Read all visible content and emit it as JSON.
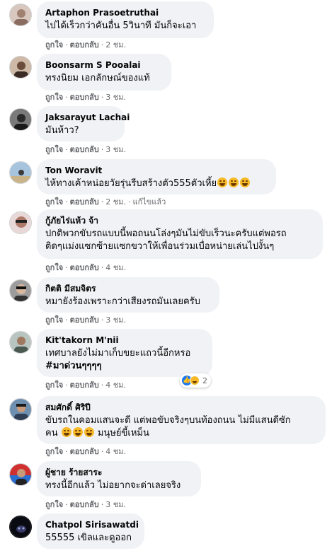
{
  "actions": {
    "like": "ถูกใจ",
    "reply": "ตอบกลับ",
    "edited": "แก้ไขแล้ว",
    "separator": "·"
  },
  "comments": [
    {
      "author": "Artaphon Prasoetruthai",
      "lines": [
        "ไปได้เร็วกว่าคันอื่น 5วินาที มันก็จะเอา"
      ],
      "time": "2 ชม."
    },
    {
      "author": "Boonsarm S Pooalai",
      "lines": [
        "ทรงนิยม เอกลักษณ์ของแท้"
      ],
      "time": "3 ชม."
    },
    {
      "author": "Jaksarayut Lachai",
      "lines": [
        "มันห้าว?"
      ],
      "time": "3 ชม."
    },
    {
      "author": "Ton Woravit",
      "lines": [
        "ไห้ทางเค้าหน่อยวัยรุ่นรีบสร้างตัว555ตัวเหี้ย"
      ],
      "time": "2 ชม."
    },
    {
      "author": "กู้ภัยไร่แห้ว จ้า",
      "lines": [
        "ปกติพวกขับรถแบบนี้พอถนนโล่งๆมันไม่ขับเร็วนะครับแต่พอรถ",
        "ติดๆแม่งแซกซ้ายแซกขวาให้เพื่อนร่วมเบื่อหน่ายเล่นไปงั้นๆ"
      ],
      "time": "4 ชม."
    },
    {
      "author": "กิตติ มีสมจิตร",
      "lines": [
        "หมายังร้องเพราะกว่าเสียงรถมันเลยครับ"
      ],
      "time": "3 ชม."
    },
    {
      "author": "Kit'takorn M'nii",
      "lines": [
        "เทศบาลยังไม่มาเก็บขยะแถวนี้อีกหรอ"
      ],
      "hashtag": "#มาด่วนๆๆๆๆ",
      "time": "4 ชม.",
      "reaction_count": "2"
    },
    {
      "author": "สมศักดิ์ ศิริปี",
      "lines": [
        "ขับรถในคอมแสนจะดี แต่พอขับจริงๆบนท้องถนน ไม่มีแสนดีซัก",
        "คน"
      ],
      "line2_suffix": "มนุษย์ขี้เหม็น",
      "time": "4 ชม."
    },
    {
      "author": "ผู้ชาย ร้ายสาระ",
      "lines": [
        "ทรงนี้อีกแล้ว ไม่อยากจะด่าเลยจริง"
      ],
      "time": "3 ชม."
    },
    {
      "author": "Chatpol Sirisawatdi",
      "lines": [
        "55555 เขิลและดูออก"
      ],
      "time": ""
    }
  ],
  "colors": {
    "bubble": "#f0f2f5",
    "meta": "#65676b",
    "like_blue": "#1877f2"
  }
}
